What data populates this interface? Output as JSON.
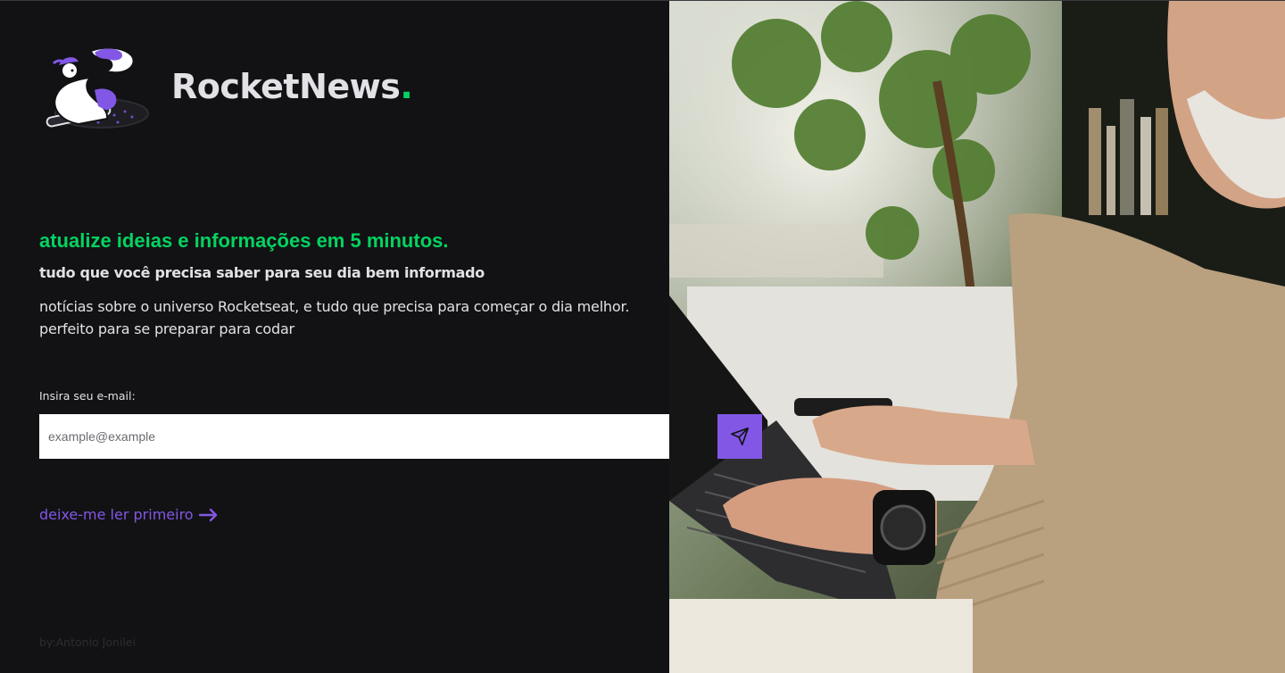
{
  "brand": {
    "name": "RocketNews",
    "dot": ".",
    "accent": "#04d361"
  },
  "hero": {
    "headline": "atualize ideias e informações em 5 minutos.",
    "subheadline": "tudo que você precisa saber para seu dia bem informado",
    "description_line1": "notícias sobre o universo Rocketseat, e tudo que precisa para começar o dia melhor.",
    "description_line2": "perfeito para se preparar para codar"
  },
  "form": {
    "email_label": "Insira seu e-mail:",
    "email_placeholder": "example@example",
    "email_value": "",
    "send_icon": "paper-plane-icon"
  },
  "link": {
    "read_first": "deixe-me ler primeiro",
    "icon": "arrow-right-icon"
  },
  "footer": {
    "credit": "by:Antonio Jonilei"
  },
  "colors": {
    "background": "#121214",
    "primary_green": "#04d361",
    "accent_purple": "#8257e5",
    "text": "#e1e1e6"
  }
}
